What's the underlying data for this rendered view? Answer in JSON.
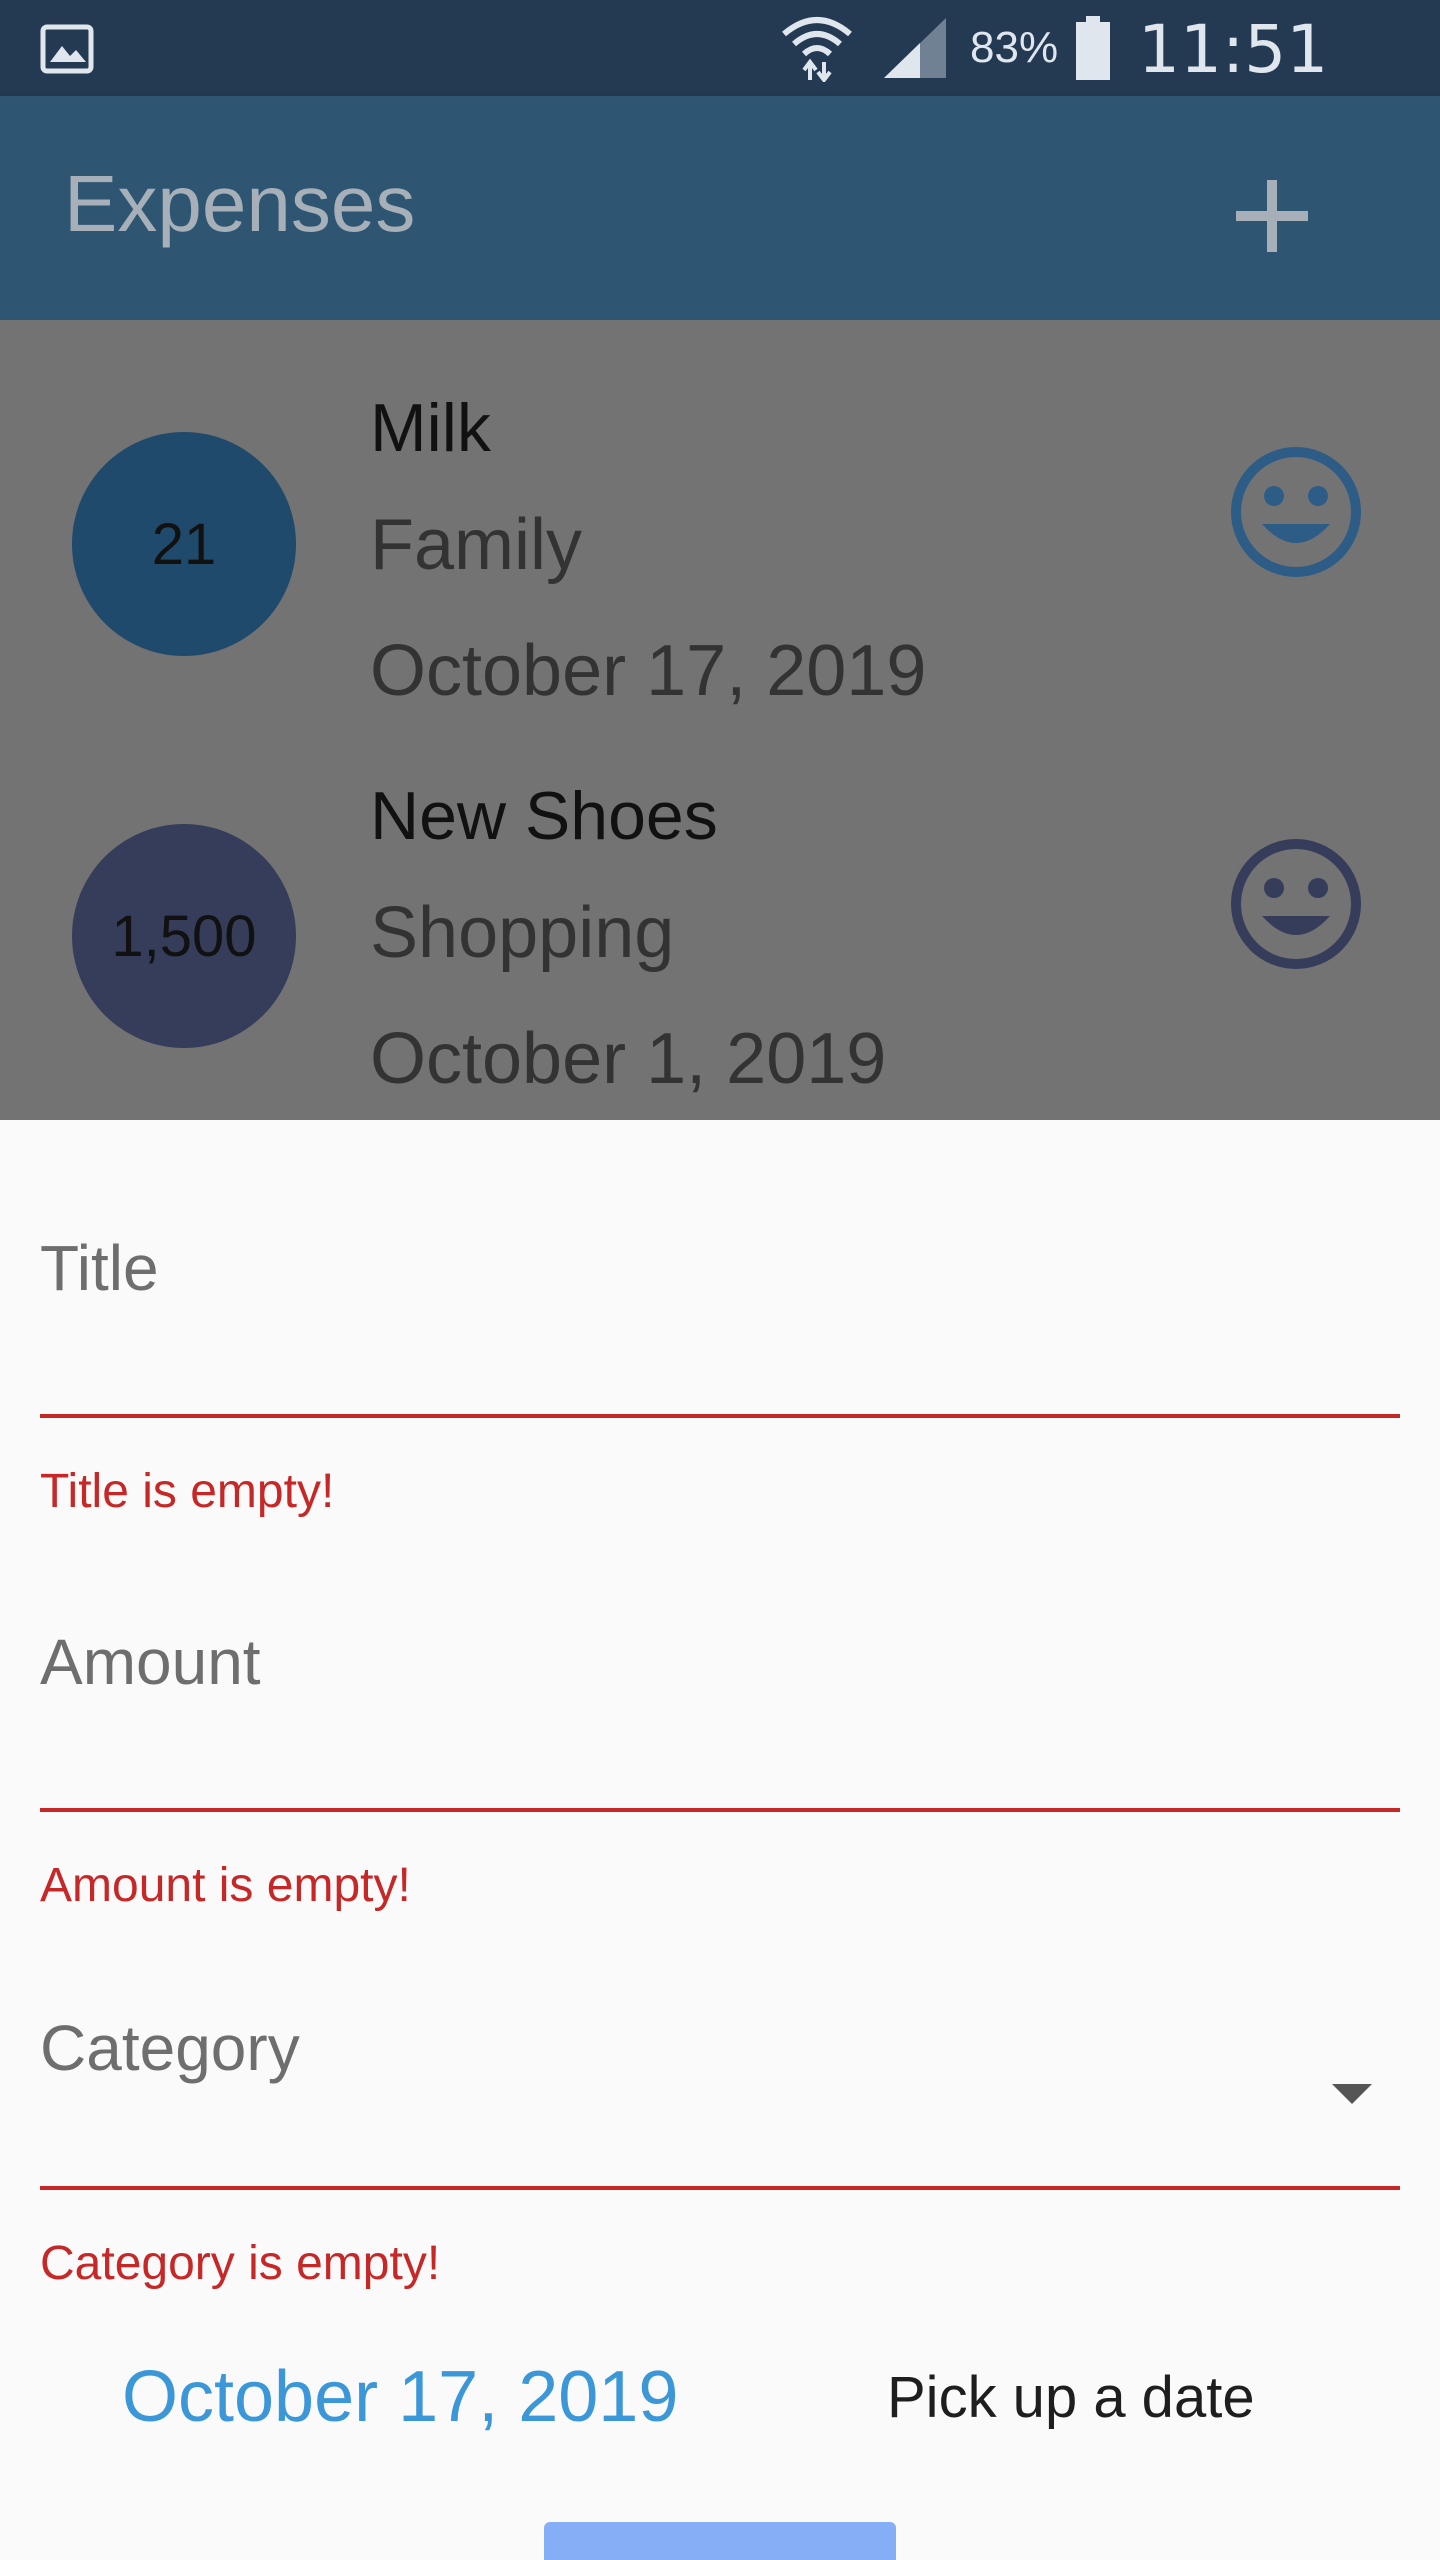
{
  "status_bar": {
    "battery": "83%",
    "time": "11:51 PM",
    "icons": [
      "gallery-icon",
      "wifi-icon",
      "signal-icon",
      "battery-icon"
    ]
  },
  "app_bar": {
    "title": "Expenses",
    "add_icon": "plus-icon"
  },
  "expenses": [
    {
      "amount": "21",
      "title": "Milk",
      "category": "Family",
      "date": "October 17, 2019",
      "avatar_color": "#1f4a6b",
      "icon": "smiley-icon"
    },
    {
      "amount": "1,500",
      "title": "New Shoes",
      "category": "Shopping",
      "date": "October 1, 2019",
      "avatar_color": "#363d5a",
      "icon": "smiley-icon"
    }
  ],
  "form": {
    "title_label": "Title",
    "title_error": "Title is empty!",
    "amount_label": "Amount",
    "amount_error": "Amount is empty!",
    "category_label": "Category",
    "category_error": "Category is empty!",
    "selected_date": "October 17, 2019",
    "pick_date_label": "Pick up a date"
  },
  "colors": {
    "status_bar": "#243a52",
    "app_bar": "#2e5572",
    "overlay": "#737373",
    "error": "#c62828",
    "date_accent": "#3b97d8",
    "submit_button": "#86aef7",
    "smiley": "#2d5d86"
  }
}
